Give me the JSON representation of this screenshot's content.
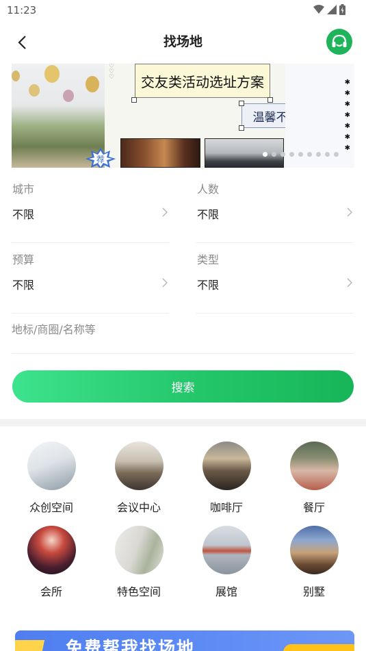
{
  "status": {
    "time": "11:23"
  },
  "nav": {
    "title": "找场地"
  },
  "banner": {
    "title": "交友类活动选址方案",
    "subtitle": "温馨不踩雷",
    "stamp": "荐",
    "dot_count": 9,
    "active_dot": 0
  },
  "filters": {
    "city": {
      "label": "城市",
      "value": "不限"
    },
    "people": {
      "label": "人数",
      "value": "不限"
    },
    "budget": {
      "label": "预算",
      "value": "不限"
    },
    "type": {
      "label": "类型",
      "value": "不限"
    }
  },
  "search": {
    "placeholder": "地标/商圈/名称等",
    "button_label": "搜索"
  },
  "categories": [
    {
      "label": "众创空间",
      "icon": "coworking-space-photo"
    },
    {
      "label": "会议中心",
      "icon": "conference-center-photo"
    },
    {
      "label": "咖啡厅",
      "icon": "cafe-photo"
    },
    {
      "label": "餐厅",
      "icon": "restaurant-photo"
    },
    {
      "label": "会所",
      "icon": "club-photo"
    },
    {
      "label": "特色空间",
      "icon": "special-space-photo"
    },
    {
      "label": "展馆",
      "icon": "exhibition-hall-photo"
    },
    {
      "label": "别墅",
      "icon": "villa-photo"
    }
  ],
  "promo": {
    "text": "免费帮我找场地"
  },
  "colors": {
    "accent": "#1fb45a",
    "button_start": "#3de38d",
    "button_end": "#17b558",
    "promo": "#5b8af5"
  }
}
